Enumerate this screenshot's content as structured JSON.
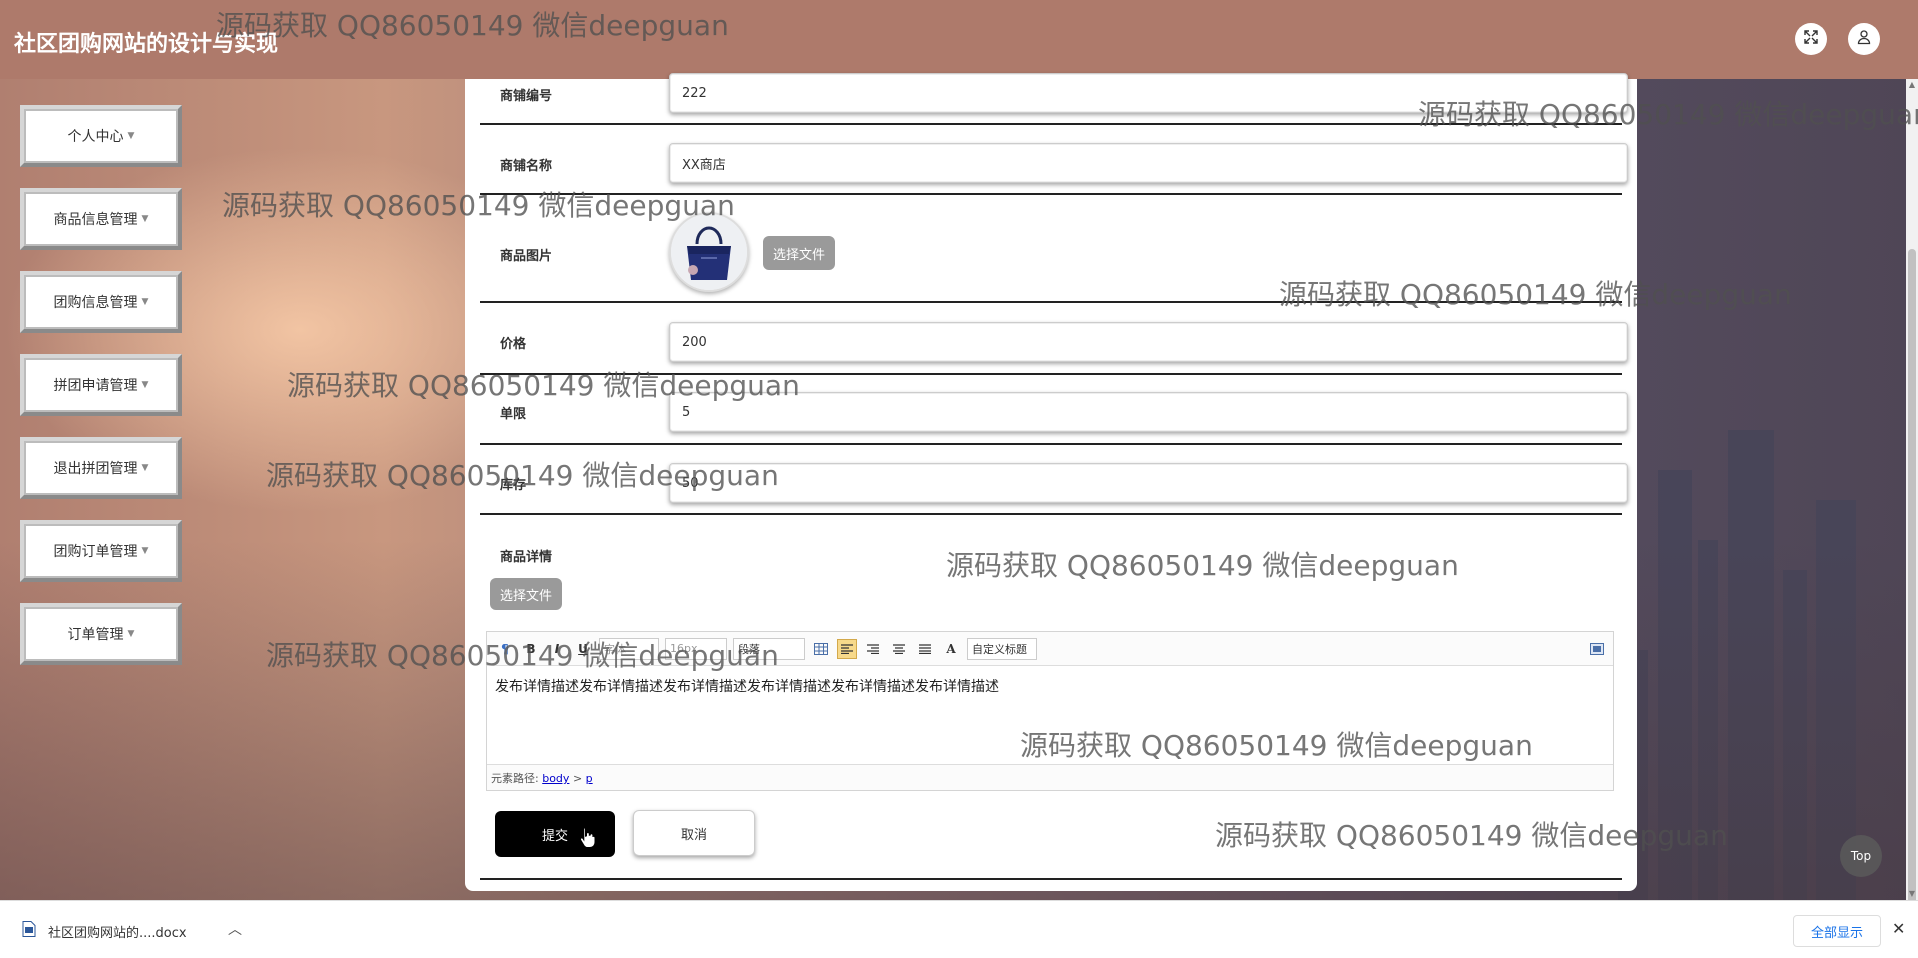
{
  "header": {
    "title": "社区团购网站的设计与实现",
    "fullscreen_icon": "fullscreen-icon",
    "user_icon": "user-icon"
  },
  "sidebar": {
    "items": [
      {
        "label": "个人中心"
      },
      {
        "label": "商品信息管理"
      },
      {
        "label": "团购信息管理"
      },
      {
        "label": "拼团申请管理"
      },
      {
        "label": "退出拼团管理"
      },
      {
        "label": "团购订单管理"
      },
      {
        "label": "订单管理"
      }
    ]
  },
  "form": {
    "shop_no": {
      "label": "商铺编号",
      "value": "222"
    },
    "shop_name": {
      "label": "商铺名称",
      "value": "XX商店"
    },
    "product_image": {
      "label": "商品图片",
      "button": "选择文件"
    },
    "price": {
      "label": "价格",
      "value": "200"
    },
    "limit": {
      "label": "单限",
      "value": "5"
    },
    "stock": {
      "label": "库存",
      "value": "50"
    },
    "details": {
      "label": "商品详情",
      "button": "选择文件"
    },
    "submit_label": "提交",
    "cancel_label": "取消"
  },
  "editor": {
    "bold": "B",
    "italic": "I",
    "underline": "U",
    "font_select": "字体",
    "size_select": "16px",
    "paragraph_select": "段落",
    "color_label": "A",
    "custom_title": "自定义标题",
    "content": "发布详情描述发布详情描述发布详情描述发布详情描述发布详情描述发布详情描述",
    "path_prefix": "元素路径:",
    "path_body": "body",
    "path_sep": ">",
    "path_p": "p"
  },
  "watermark": "源码获取 QQ86050149 微信deepguan",
  "top_button": "Top",
  "download_bar": {
    "file_name": "社区团购网站的....docx",
    "show_all": "全部显示",
    "close": "✕"
  },
  "colors": {
    "header_bg": "#ae7a6b",
    "submit_bg": "#000000",
    "file_button_bg": "#9a9a9a",
    "link": "#1a73e8"
  }
}
